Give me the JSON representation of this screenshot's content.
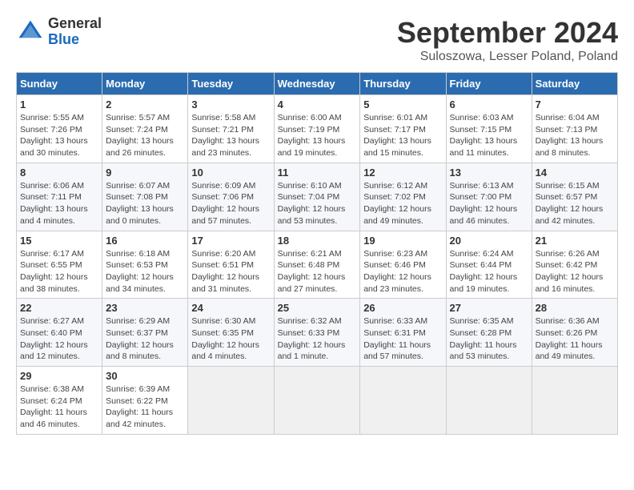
{
  "header": {
    "logo": {
      "general": "General",
      "blue": "Blue"
    },
    "title": "September 2024",
    "location": "Suloszowa, Lesser Poland, Poland"
  },
  "calendar": {
    "days_of_week": [
      "Sunday",
      "Monday",
      "Tuesday",
      "Wednesday",
      "Thursday",
      "Friday",
      "Saturday"
    ],
    "weeks": [
      [
        null,
        {
          "day": "2",
          "sunrise": "Sunrise: 5:57 AM",
          "sunset": "Sunset: 7:24 PM",
          "daylight": "Daylight: 13 hours and 26 minutes."
        },
        {
          "day": "3",
          "sunrise": "Sunrise: 5:58 AM",
          "sunset": "Sunset: 7:21 PM",
          "daylight": "Daylight: 13 hours and 23 minutes."
        },
        {
          "day": "4",
          "sunrise": "Sunrise: 6:00 AM",
          "sunset": "Sunset: 7:19 PM",
          "daylight": "Daylight: 13 hours and 19 minutes."
        },
        {
          "day": "5",
          "sunrise": "Sunrise: 6:01 AM",
          "sunset": "Sunset: 7:17 PM",
          "daylight": "Daylight: 13 hours and 15 minutes."
        },
        {
          "day": "6",
          "sunrise": "Sunrise: 6:03 AM",
          "sunset": "Sunset: 7:15 PM",
          "daylight": "Daylight: 13 hours and 11 minutes."
        },
        {
          "day": "7",
          "sunrise": "Sunrise: 6:04 AM",
          "sunset": "Sunset: 7:13 PM",
          "daylight": "Daylight: 13 hours and 8 minutes."
        }
      ],
      [
        {
          "day": "1",
          "sunrise": "Sunrise: 5:55 AM",
          "sunset": "Sunset: 7:26 PM",
          "daylight": "Daylight: 13 hours and 30 minutes."
        },
        {
          "day": "9",
          "sunrise": "Sunrise: 6:07 AM",
          "sunset": "Sunset: 7:08 PM",
          "daylight": "Daylight: 13 hours and 0 minutes."
        },
        {
          "day": "10",
          "sunrise": "Sunrise: 6:09 AM",
          "sunset": "Sunset: 7:06 PM",
          "daylight": "Daylight: 12 hours and 57 minutes."
        },
        {
          "day": "11",
          "sunrise": "Sunrise: 6:10 AM",
          "sunset": "Sunset: 7:04 PM",
          "daylight": "Daylight: 12 hours and 53 minutes."
        },
        {
          "day": "12",
          "sunrise": "Sunrise: 6:12 AM",
          "sunset": "Sunset: 7:02 PM",
          "daylight": "Daylight: 12 hours and 49 minutes."
        },
        {
          "day": "13",
          "sunrise": "Sunrise: 6:13 AM",
          "sunset": "Sunset: 7:00 PM",
          "daylight": "Daylight: 12 hours and 46 minutes."
        },
        {
          "day": "14",
          "sunrise": "Sunrise: 6:15 AM",
          "sunset": "Sunset: 6:57 PM",
          "daylight": "Daylight: 12 hours and 42 minutes."
        }
      ],
      [
        {
          "day": "8",
          "sunrise": "Sunrise: 6:06 AM",
          "sunset": "Sunset: 7:11 PM",
          "daylight": "Daylight: 13 hours and 4 minutes."
        },
        {
          "day": "16",
          "sunrise": "Sunrise: 6:18 AM",
          "sunset": "Sunset: 6:53 PM",
          "daylight": "Daylight: 12 hours and 34 minutes."
        },
        {
          "day": "17",
          "sunrise": "Sunrise: 6:20 AM",
          "sunset": "Sunset: 6:51 PM",
          "daylight": "Daylight: 12 hours and 31 minutes."
        },
        {
          "day": "18",
          "sunrise": "Sunrise: 6:21 AM",
          "sunset": "Sunset: 6:48 PM",
          "daylight": "Daylight: 12 hours and 27 minutes."
        },
        {
          "day": "19",
          "sunrise": "Sunrise: 6:23 AM",
          "sunset": "Sunset: 6:46 PM",
          "daylight": "Daylight: 12 hours and 23 minutes."
        },
        {
          "day": "20",
          "sunrise": "Sunrise: 6:24 AM",
          "sunset": "Sunset: 6:44 PM",
          "daylight": "Daylight: 12 hours and 19 minutes."
        },
        {
          "day": "21",
          "sunrise": "Sunrise: 6:26 AM",
          "sunset": "Sunset: 6:42 PM",
          "daylight": "Daylight: 12 hours and 16 minutes."
        }
      ],
      [
        {
          "day": "15",
          "sunrise": "Sunrise: 6:17 AM",
          "sunset": "Sunset: 6:55 PM",
          "daylight": "Daylight: 12 hours and 38 minutes."
        },
        {
          "day": "23",
          "sunrise": "Sunrise: 6:29 AM",
          "sunset": "Sunset: 6:37 PM",
          "daylight": "Daylight: 12 hours and 8 minutes."
        },
        {
          "day": "24",
          "sunrise": "Sunrise: 6:30 AM",
          "sunset": "Sunset: 6:35 PM",
          "daylight": "Daylight: 12 hours and 4 minutes."
        },
        {
          "day": "25",
          "sunrise": "Sunrise: 6:32 AM",
          "sunset": "Sunset: 6:33 PM",
          "daylight": "Daylight: 12 hours and 1 minute."
        },
        {
          "day": "26",
          "sunrise": "Sunrise: 6:33 AM",
          "sunset": "Sunset: 6:31 PM",
          "daylight": "Daylight: 11 hours and 57 minutes."
        },
        {
          "day": "27",
          "sunrise": "Sunrise: 6:35 AM",
          "sunset": "Sunset: 6:28 PM",
          "daylight": "Daylight: 11 hours and 53 minutes."
        },
        {
          "day": "28",
          "sunrise": "Sunrise: 6:36 AM",
          "sunset": "Sunset: 6:26 PM",
          "daylight": "Daylight: 11 hours and 49 minutes."
        }
      ],
      [
        {
          "day": "22",
          "sunrise": "Sunrise: 6:27 AM",
          "sunset": "Sunset: 6:40 PM",
          "daylight": "Daylight: 12 hours and 12 minutes."
        },
        {
          "day": "30",
          "sunrise": "Sunrise: 6:39 AM",
          "sunset": "Sunset: 6:22 PM",
          "daylight": "Daylight: 11 hours and 42 minutes."
        },
        null,
        null,
        null,
        null,
        null
      ],
      [
        {
          "day": "29",
          "sunrise": "Sunrise: 6:38 AM",
          "sunset": "Sunset: 6:24 PM",
          "daylight": "Daylight: 11 hours and 46 minutes."
        },
        null,
        null,
        null,
        null,
        null,
        null
      ]
    ]
  }
}
